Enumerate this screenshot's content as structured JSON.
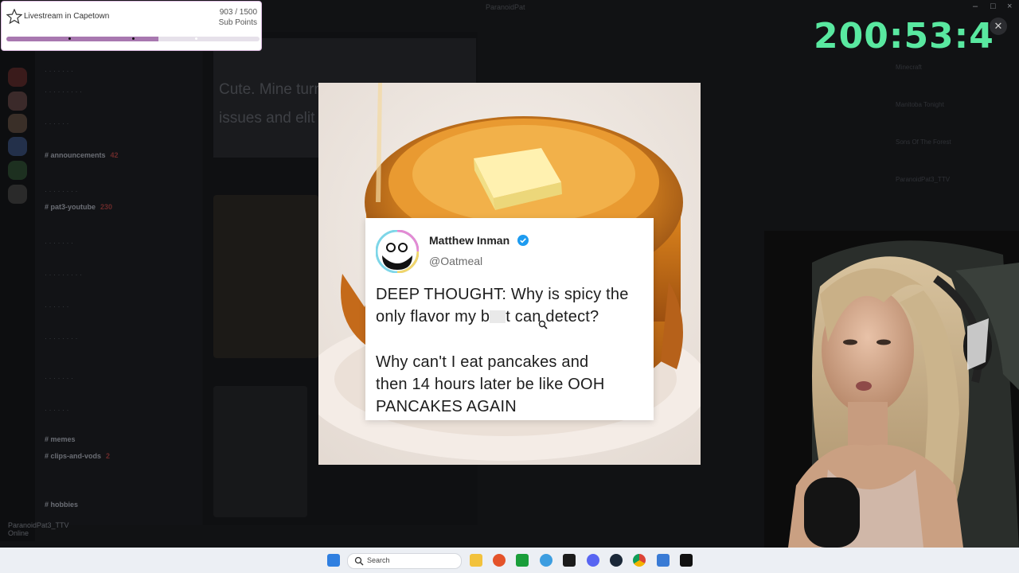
{
  "sub_widget": {
    "title": "Livestream in Capetown",
    "count": "903 / 1500",
    "unit": "Sub Points",
    "progress_fraction": 0.602
  },
  "timer": {
    "text": "200:53:4"
  },
  "discord": {
    "window_title": "ParanoidPat",
    "channels": [
      "announcements",
      "pat3-youtube",
      "memes",
      "clips-and-vods",
      "hobbies"
    ],
    "channel_badges": {
      "announcements": "42",
      "pat3-youtube": "230",
      "clips-and-vods": "2"
    },
    "user_name": "ParanoidPat3_TTV",
    "user_status": "Online",
    "chat_preview_text": "Cute. Mine turns into a sarcastic legal issues and elit"
  },
  "right_panel": {
    "items": [
      "Minecraft",
      "Manitoba Tonight",
      "Sons Of The Forest",
      "ParanoidPat3_TTV"
    ]
  },
  "tweet": {
    "name": "Matthew Inman",
    "handle": "@Oatmeal",
    "line1": "DEEP THOUGHT: Why is spicy the",
    "line2_before": "only flavor my b",
    "line2_after": "t can detect?",
    "line3": "Why can't I eat pancakes and",
    "line4": "then 14 hours later be like OOH",
    "line5": "PANCAKES AGAIN"
  },
  "taskbar": {
    "search_placeholder": "Search"
  },
  "colors": {
    "timer": "#59e8a0",
    "sub_fill": "#a878b0",
    "verified": "#1d9bf0",
    "taskbar": "#eceff4"
  }
}
